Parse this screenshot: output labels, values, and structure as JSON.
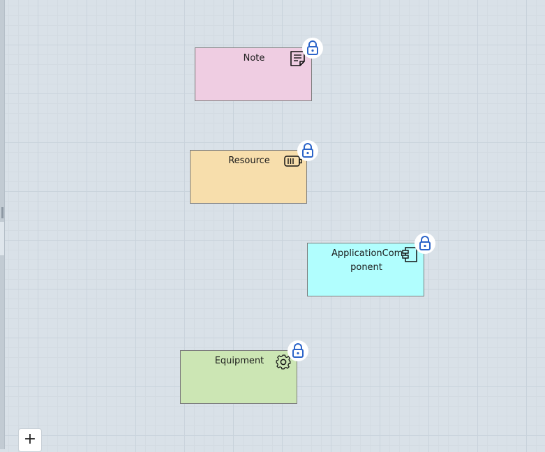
{
  "colors": {
    "note_fill": "#efcde2",
    "resource_fill": "#f7deac",
    "application_component_fill": "#b1fefe",
    "equipment_fill": "#cce6b4",
    "lock_color": "#2b64c9"
  },
  "nodes": [
    {
      "id": "note",
      "label": "Note",
      "icon": "note-icon",
      "locked": true
    },
    {
      "id": "resource",
      "label": "Resource",
      "icon": "battery-icon",
      "locked": true
    },
    {
      "id": "application-component",
      "label_line1": "ApplicationCom",
      "label_line2": "ponent",
      "icon": "component-icon",
      "locked": true
    },
    {
      "id": "equipment",
      "label": "Equipment",
      "icon": "gear-icon",
      "locked": true
    }
  ],
  "toolbar": {
    "add_label": "+"
  }
}
